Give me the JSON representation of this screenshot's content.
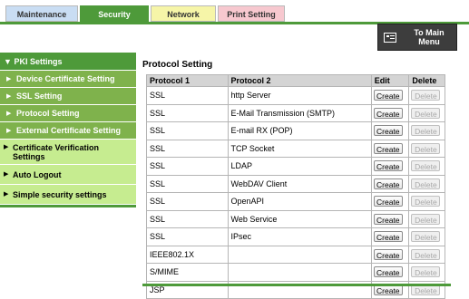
{
  "tabs": [
    {
      "label": "Maintenance"
    },
    {
      "label": "Security"
    },
    {
      "label": "Network"
    },
    {
      "label": "Print Setting"
    }
  ],
  "main_menu_button": {
    "label_line1": "To Main",
    "label_line2": "Menu",
    "icon": "menu-icon"
  },
  "sidebar": {
    "header": {
      "label": "PKI Settings"
    },
    "sub_items": [
      {
        "label": "Device Certificate Setting"
      },
      {
        "label": "SSL Setting"
      },
      {
        "label": "Protocol Setting"
      },
      {
        "label": "External Certificate Setting"
      }
    ],
    "top_items": [
      {
        "label_line1": "Certificate Verification",
        "label_line2": "Settings"
      },
      {
        "label": "Auto Logout"
      },
      {
        "label": "Simple security settings"
      }
    ]
  },
  "page_title": "Protocol Setting",
  "table": {
    "headers": [
      "Protocol 1",
      "Protocol 2",
      "Edit",
      "Delete"
    ],
    "create_label": "Create",
    "delete_label": "Delete",
    "rows": [
      {
        "p1": "SSL",
        "p2": "http Server"
      },
      {
        "p1": "SSL",
        "p2": "E-Mail Transmission (SMTP)"
      },
      {
        "p1": "SSL",
        "p2": "E-mail RX (POP)"
      },
      {
        "p1": "SSL",
        "p2": "TCP Socket"
      },
      {
        "p1": "SSL",
        "p2": "LDAP"
      },
      {
        "p1": "SSL",
        "p2": "WebDAV Client"
      },
      {
        "p1": "SSL",
        "p2": "OpenAPI"
      },
      {
        "p1": "SSL",
        "p2": "Web Service"
      },
      {
        "p1": "SSL",
        "p2": "IPsec"
      },
      {
        "p1": "IEEE802.1X",
        "p2": ""
      },
      {
        "p1": "S/MIME",
        "p2": ""
      },
      {
        "p1": "JSP",
        "p2": ""
      }
    ]
  },
  "colors": {
    "accent": "#4e9a3a",
    "submenu": "#7fb24c",
    "menu_light": "#c6ec90"
  }
}
